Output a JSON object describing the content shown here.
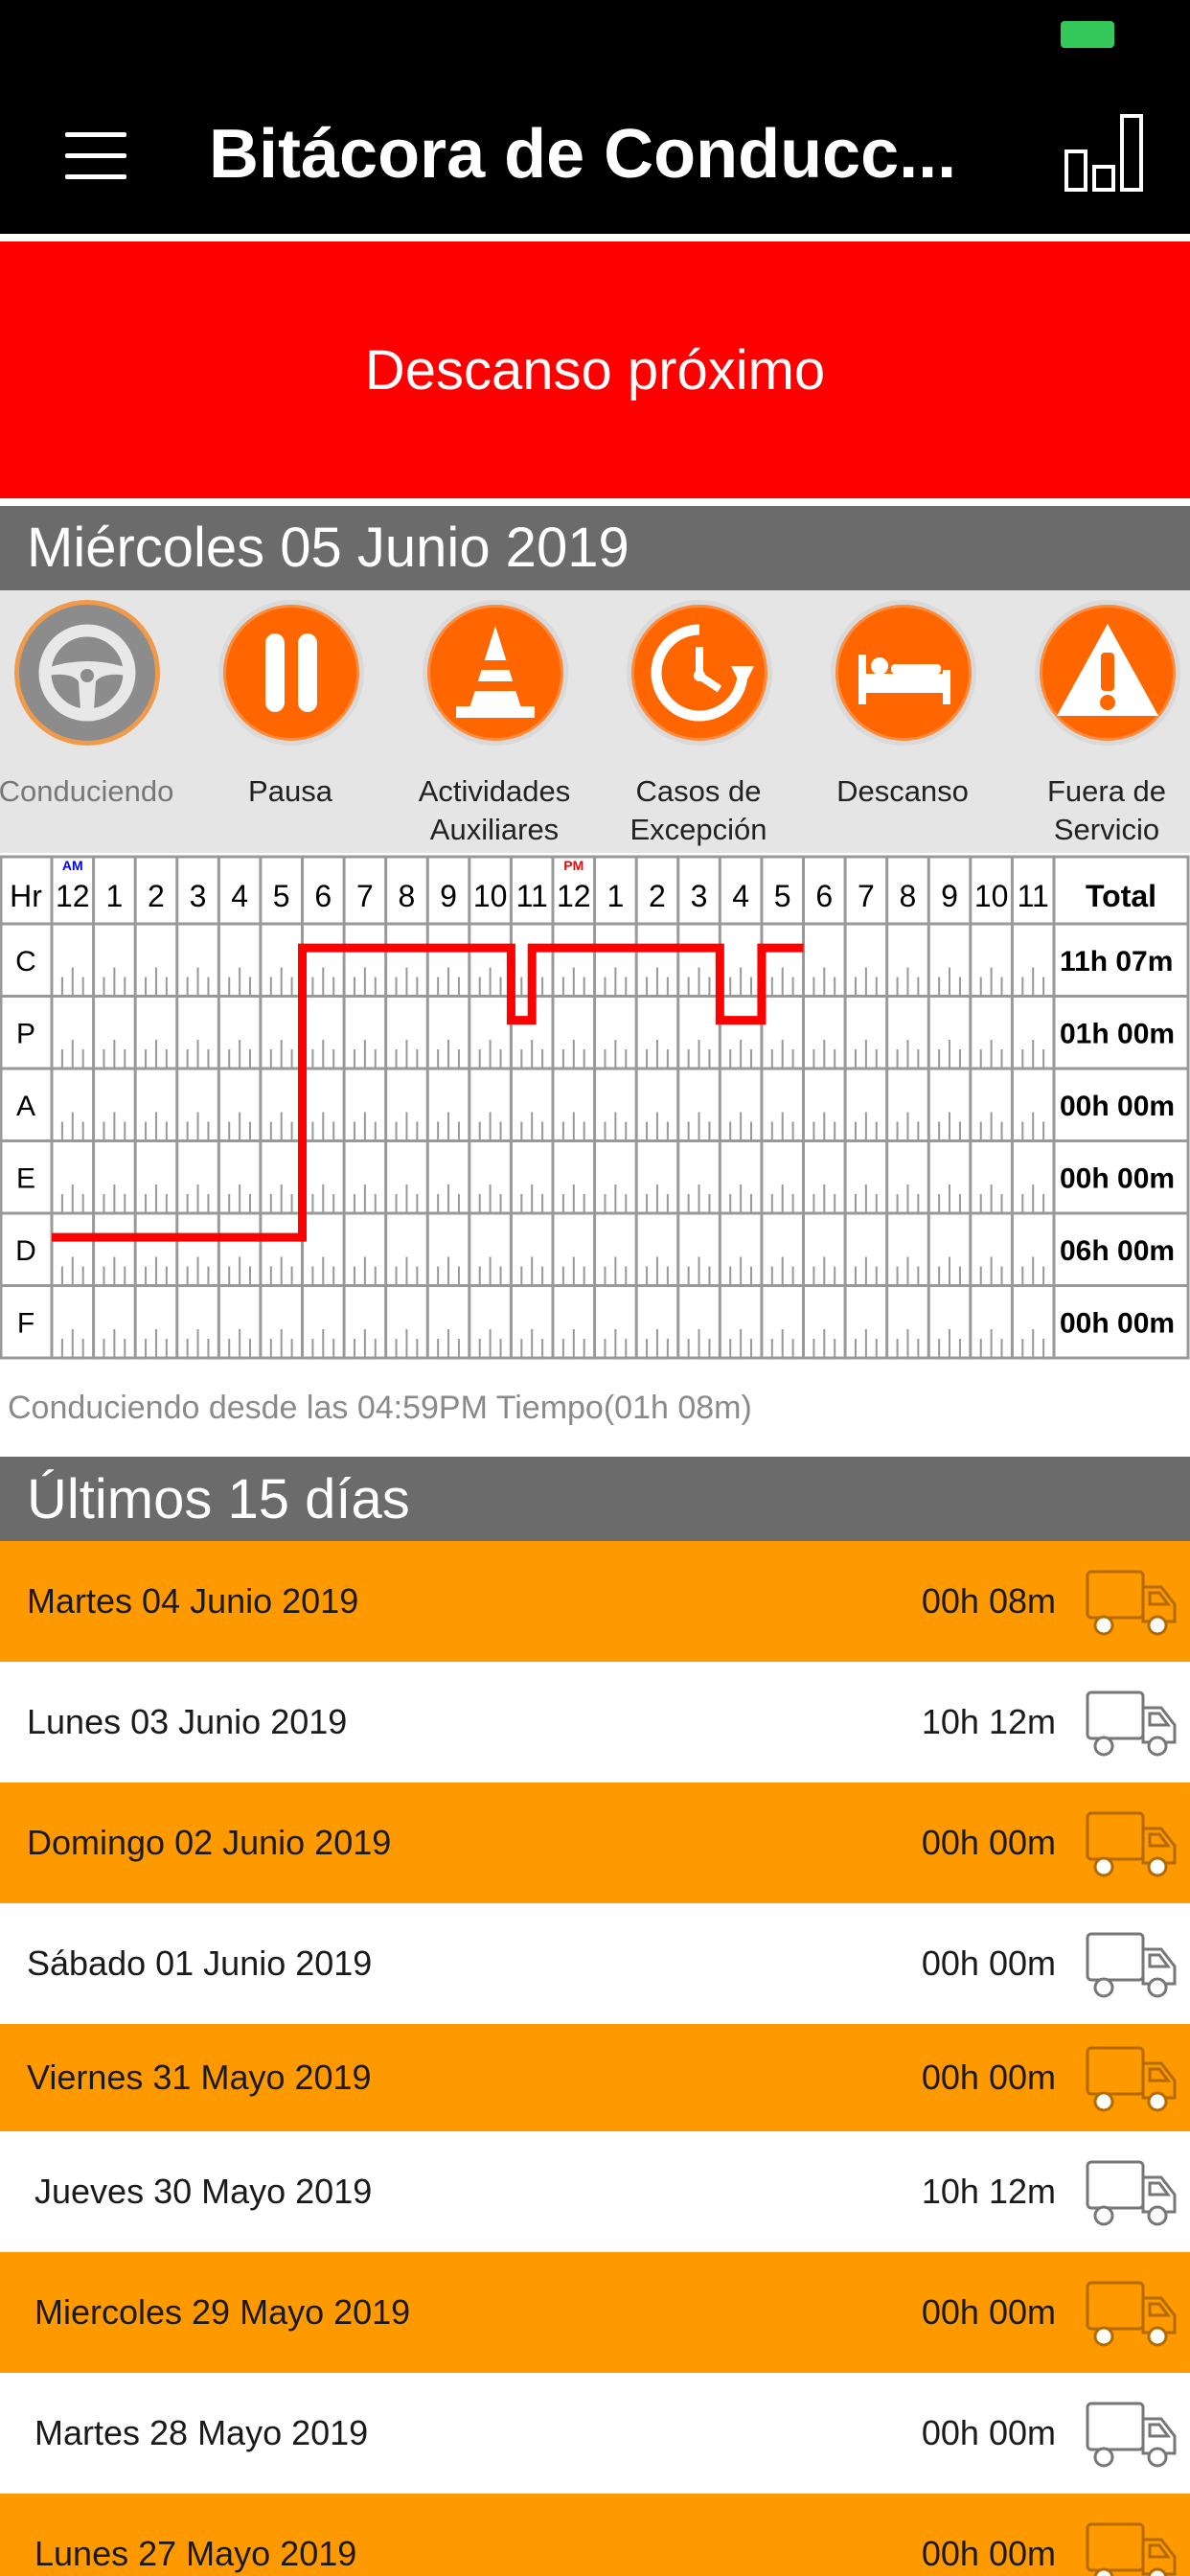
{
  "header": {
    "title": "Bitácora de Conducc..."
  },
  "banner": {
    "text": "Descanso próximo"
  },
  "current_day": {
    "label": "Miércoles 05 Junio 2019"
  },
  "statuses": [
    {
      "label": "Conduciendo",
      "icon": "steering-wheel-icon",
      "active": true
    },
    {
      "label": "Pausa",
      "icon": "pause-icon",
      "active": false
    },
    {
      "label": "Actividades\nAuxiliares",
      "icon": "traffic-cone-icon",
      "active": false
    },
    {
      "label": "Casos de\nExcepción",
      "icon": "clock-icon",
      "active": false
    },
    {
      "label": "Descanso",
      "icon": "bed-icon",
      "active": false
    },
    {
      "label": "Fuera de\nServicio",
      "icon": "warning-icon",
      "active": false
    }
  ],
  "log_grid": {
    "header_label": "Hr",
    "total_label": "Total",
    "am_marker": "AM",
    "pm_marker": "PM",
    "hours": [
      "12",
      "1",
      "2",
      "3",
      "4",
      "5",
      "6",
      "7",
      "8",
      "9",
      "10",
      "11",
      "12",
      "1",
      "2",
      "3",
      "4",
      "5",
      "6",
      "7",
      "8",
      "9",
      "10",
      "11"
    ],
    "rows": [
      {
        "code": "C",
        "total": "11h 07m"
      },
      {
        "code": "P",
        "total": "01h 00m"
      },
      {
        "code": "A",
        "total": "00h 00m"
      },
      {
        "code": "E",
        "total": "00h 00m"
      },
      {
        "code": "D",
        "total": "06h 00m"
      },
      {
        "code": "F",
        "total": "00h 00m"
      }
    ],
    "line_color": "#ff0000",
    "duty_path": [
      {
        "status": "D",
        "start": 0,
        "end": 6
      },
      {
        "status": "C",
        "start": 6,
        "end": 11
      },
      {
        "status": "P",
        "start": 11,
        "end": 11.5
      },
      {
        "status": "C",
        "start": 11.5,
        "end": 16
      },
      {
        "status": "P",
        "start": 16,
        "end": 17
      },
      {
        "status": "C",
        "start": 17,
        "end": 18
      }
    ]
  },
  "driving_since": "Conduciendo desde las 04:59PM Tiempo(01h 08m)",
  "last15": {
    "title": "Últimos 15 días",
    "days": [
      {
        "date": "Martes 04 Junio 2019",
        "time": "00h 08m"
      },
      {
        "date": "Lunes 03 Junio 2019",
        "time": "10h 12m"
      },
      {
        "date": "Domingo 02 Junio 2019",
        "time": "00h 00m"
      },
      {
        "date": "Sábado 01 Junio 2019",
        "time": "00h 00m"
      },
      {
        "date": "Viernes 31 Mayo 2019",
        "time": "00h 00m"
      },
      {
        "date": "Jueves 30 Mayo 2019",
        "time": "10h 12m"
      },
      {
        "date": "Miercoles 29 Mayo 2019",
        "time": "00h 00m"
      },
      {
        "date": "Martes 28 Mayo 2019",
        "time": "00h 00m"
      },
      {
        "date": "Lunes 27 Mayo 2019",
        "time": "00h 00m"
      }
    ]
  },
  "colors": {
    "orange": "#ff9900",
    "status_orange": "#ff6600",
    "banner_red": "#ff0000",
    "header_gray": "#6b6b6b"
  }
}
